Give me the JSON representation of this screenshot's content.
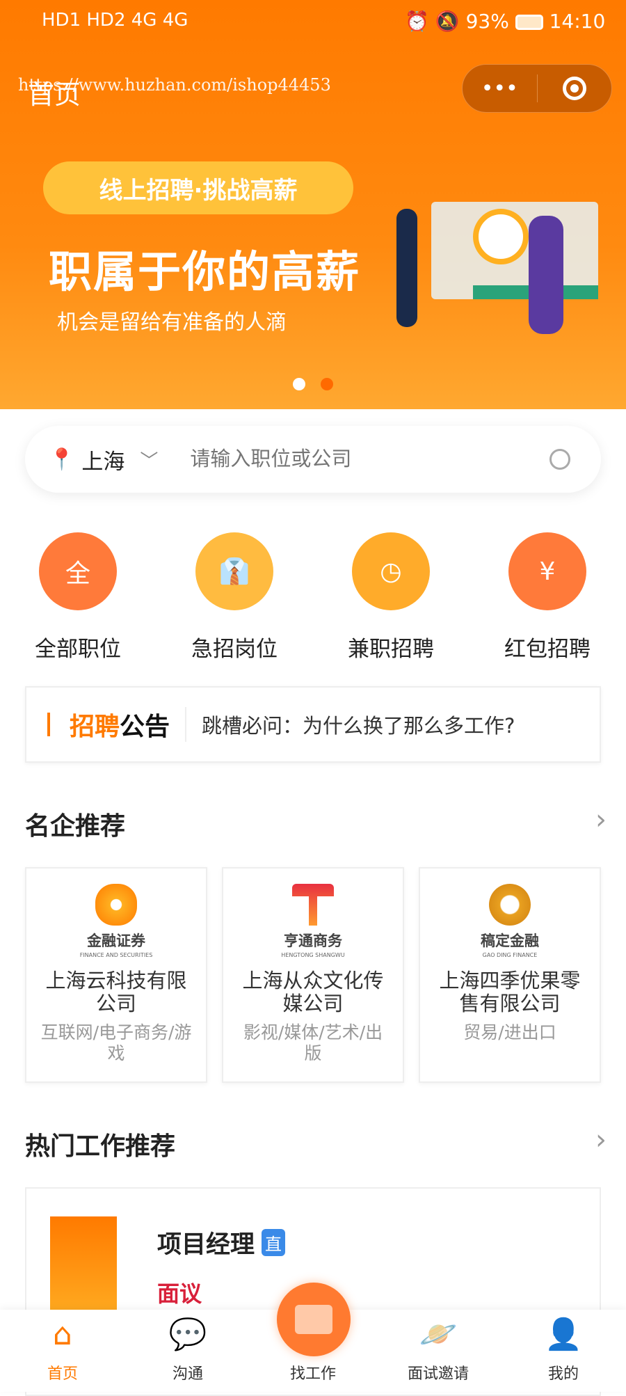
{
  "status_bar": {
    "left": "HD1 HD2 4G 4G",
    "battery": "93%",
    "time": "14:10"
  },
  "nav": {
    "title": "首页",
    "watermark": "https://www.huzhan.com/ishop44453",
    "more_icon": "more-dots-icon",
    "target_icon": "target-icon"
  },
  "banner": {
    "pill": "线上招聘·挑战高薪",
    "headline": "职属于你的高薪",
    "subtitle": "机会是留给有准备的人滴",
    "active_dot": 1,
    "accent": "#ff7a00"
  },
  "search": {
    "city": "上海",
    "placeholder": "请输入职位或公司"
  },
  "categories": [
    {
      "label": "全部职位",
      "glyph": "全",
      "color": "#ff7a3a"
    },
    {
      "label": "急招岗位",
      "glyph": "👔",
      "color": "#ffbb40"
    },
    {
      "label": "兼职招聘",
      "glyph": "◷",
      "color": "#ffab2a"
    },
    {
      "label": "红包招聘",
      "glyph": "¥",
      "color": "#ff7a3a"
    }
  ],
  "notice": {
    "tag_a": "招聘",
    "tag_b": "公告",
    "text": "跳槽必问：为什么换了那么多工作?"
  },
  "companies_section": {
    "title": "名企推荐"
  },
  "companies": [
    {
      "logo_text": "金融证券",
      "logo_sub": "FINANCE AND SECURITIES",
      "name": "上海云科技有限公司",
      "industry": "互联网/电子商务/游戏"
    },
    {
      "logo_text": "亨通商务",
      "logo_sub": "HENGTONG SHANGWU",
      "name": "上海从众文化传媒公司",
      "industry": "影视/媒体/艺术/出版"
    },
    {
      "logo_text": "稿定金融",
      "logo_sub": "GAO DING FINANCE",
      "name": "上海四季优果零售有限公司",
      "industry": "贸易/进出口"
    }
  ],
  "jobs_section": {
    "title": "热门工作推荐"
  },
  "job": {
    "title": "项目经理",
    "badge": "直",
    "salary": "面议"
  },
  "tabs": [
    {
      "label": "首页",
      "active": true
    },
    {
      "label": "沟通"
    },
    {
      "label": "找工作"
    },
    {
      "label": "面试邀请"
    },
    {
      "label": "我的"
    }
  ]
}
